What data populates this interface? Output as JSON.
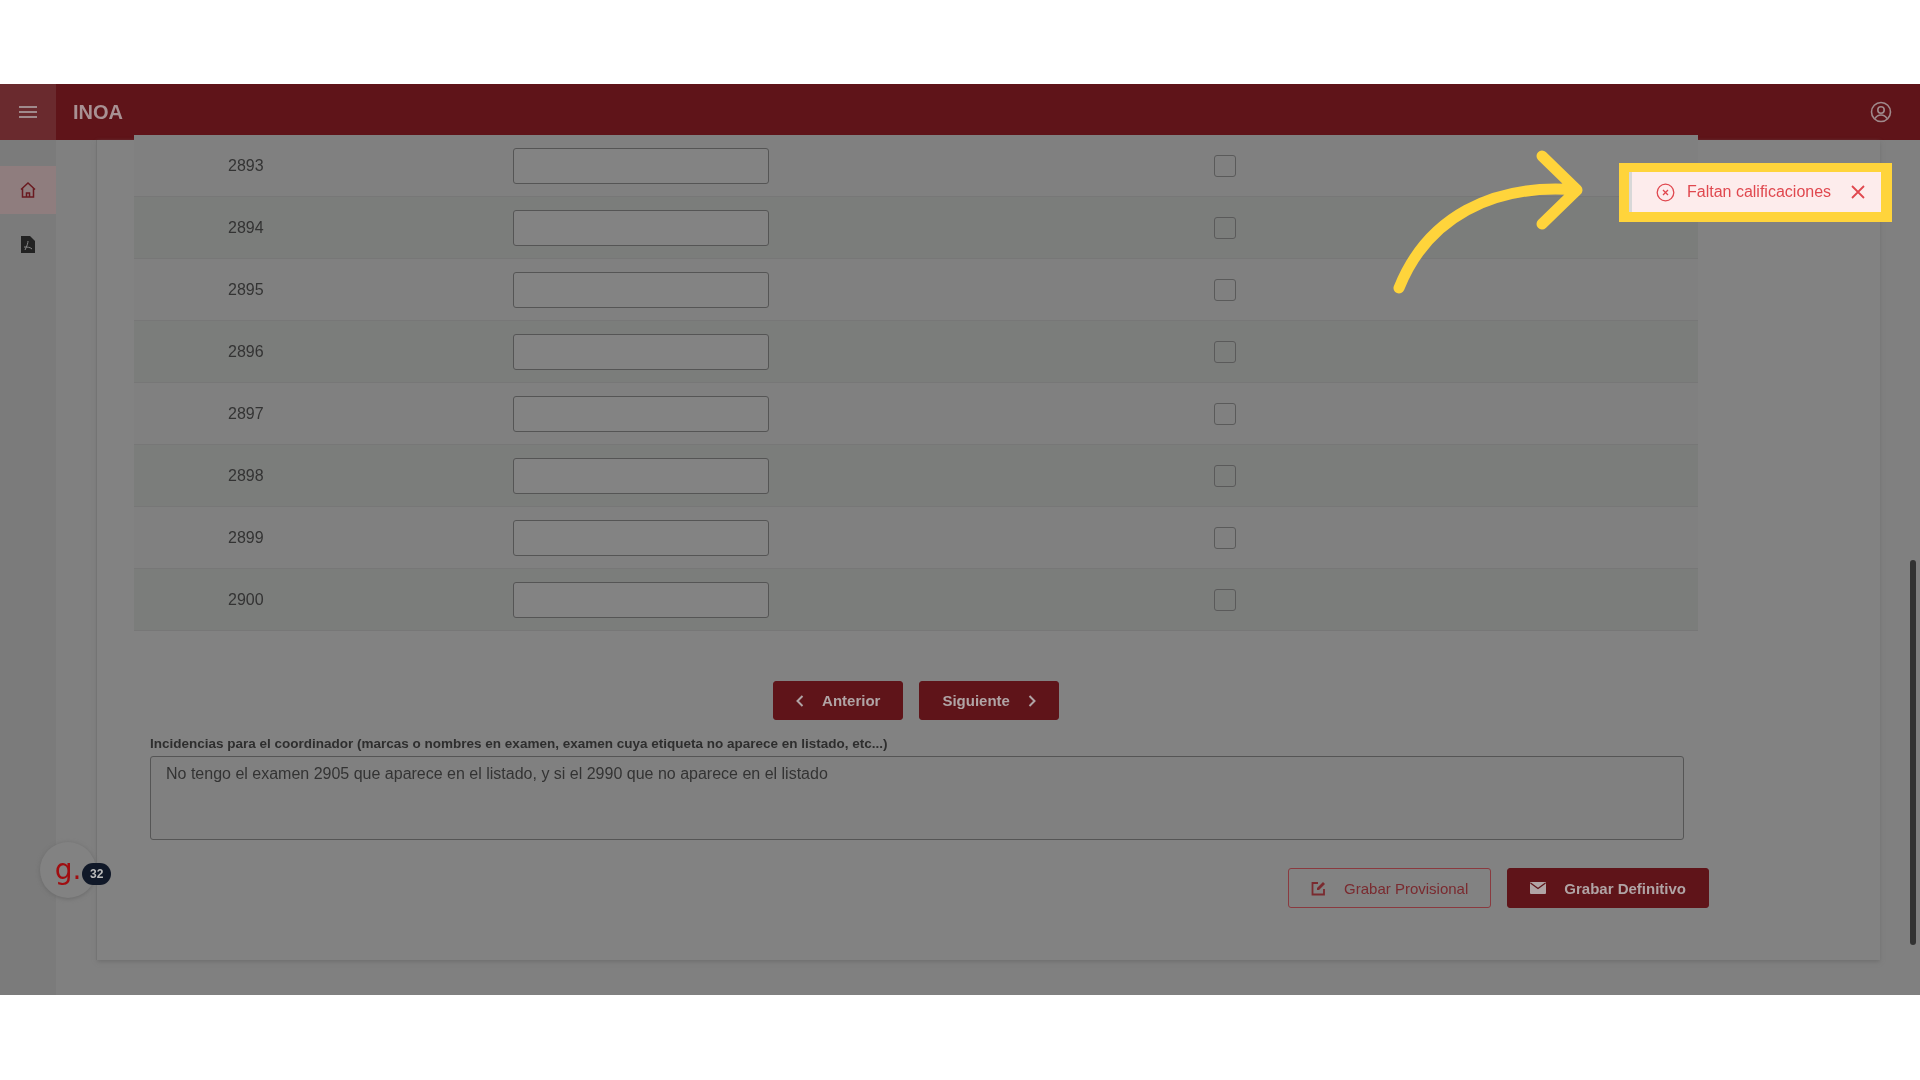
{
  "header": {
    "title": "INOA"
  },
  "sidebar": {
    "items": [
      {
        "kind": "home",
        "selected": true
      },
      {
        "kind": "pdf",
        "selected": false
      }
    ]
  },
  "table": {
    "rows": [
      {
        "number": "2893",
        "value": "",
        "checked": false
      },
      {
        "number": "2894",
        "checked": false
      },
      {
        "number": "2895",
        "checked": false
      },
      {
        "number": "2896",
        "checked": false
      },
      {
        "number": "2897",
        "checked": false
      },
      {
        "number": "2898",
        "checked": false
      },
      {
        "number": "2899",
        "checked": false
      },
      {
        "number": "2900",
        "checked": false
      }
    ]
  },
  "pagination": {
    "previous": "Anterior",
    "next": "Siguiente"
  },
  "incidents": {
    "label": "Incidencias para el coordinador (marcas o nombres en examen, examen cuya etiqueta no aparece en listado, etc...)",
    "value": "No tengo el examen 2905 que aparece en el listado, y si el 2990 que no aparece en el listado"
  },
  "actions": {
    "save_draft": "Grabar Provisional",
    "save_final": "Grabar Definitivo"
  },
  "toast": {
    "message": "Faltan calificaciones"
  },
  "chat_widget": {
    "logo": "g.",
    "count": "32"
  }
}
